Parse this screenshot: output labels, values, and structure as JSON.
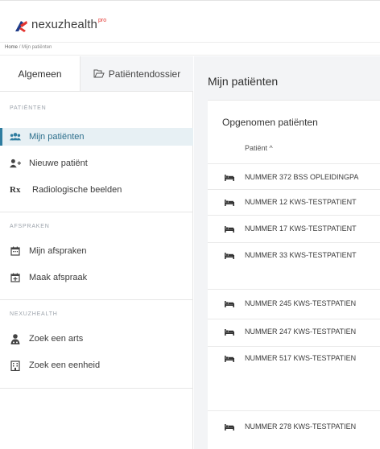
{
  "brand": {
    "name": "nexuzhealth",
    "sup": "pro"
  },
  "breadcrumb": {
    "home": "Home",
    "sep": "/",
    "current": "Mijn patiënten"
  },
  "sidebar": {
    "tabs": [
      {
        "label": "Algemeen"
      },
      {
        "label": "Patiëntendossier"
      }
    ],
    "sections": [
      {
        "title": "PATIËNTEN",
        "items": [
          {
            "label": "Mijn patiënten",
            "icon": "users-icon",
            "active": true
          },
          {
            "label": "Nieuwe patiënt",
            "icon": "user-plus-icon"
          },
          {
            "label": "Radiologische beelden",
            "icon": "rx-icon",
            "glyph": "Rx"
          }
        ]
      },
      {
        "title": "AFSPRAKEN",
        "items": [
          {
            "label": "Mijn afspraken",
            "icon": "calendar-icon"
          },
          {
            "label": "Maak afspraak",
            "icon": "calendar-plus-icon"
          }
        ]
      },
      {
        "title": "NEXUZHEALTH",
        "items": [
          {
            "label": "Zoek een arts",
            "icon": "doctor-icon"
          },
          {
            "label": "Zoek een eenheid",
            "icon": "building-icon"
          }
        ]
      }
    ]
  },
  "main": {
    "title": "Mijn patiënten",
    "card_title": "Opgenomen patiënten",
    "column_header": "Patiënt ^",
    "patients": [
      "NUMMER 372 BSS OPLEIDINGPA",
      "NUMMER 12 KWS-TESTPATIENT",
      "NUMMER 17 KWS-TESTPATIENT",
      "NUMMER 33 KWS-TESTPATIENT",
      "NUMMER 245 KWS-TESTPATIEN",
      "NUMMER 247 KWS-TESTPATIEN",
      "NUMMER 517 KWS-TESTPATIEN",
      "NUMMER 278 KWS-TESTPATIEN"
    ]
  },
  "colors": {
    "accent": "#2f7da0",
    "active_bg": "#e7f0f4",
    "logo_blue": "#1f3d8a",
    "logo_red": "#e3342f"
  }
}
